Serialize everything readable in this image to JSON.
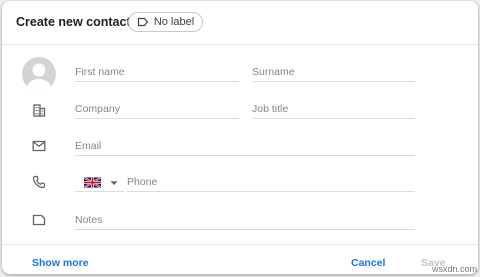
{
  "dialog": {
    "title": "Create new contact",
    "label_chip": {
      "text": "No label",
      "icon": "label-icon"
    }
  },
  "fields": {
    "first_name": {
      "placeholder": "First name"
    },
    "surname": {
      "placeholder": "Surname"
    },
    "company": {
      "placeholder": "Company"
    },
    "job_title": {
      "placeholder": "Job title"
    },
    "email": {
      "placeholder": "Email"
    },
    "phone": {
      "placeholder": "Phone",
      "country": "United Kingdom"
    },
    "notes": {
      "placeholder": "Notes"
    }
  },
  "icons": {
    "avatar": "avatar-placeholder-icon",
    "company": "building-icon",
    "email": "mail-icon",
    "phone": "phone-icon",
    "notes": "notes-icon",
    "flag": "uk-flag-icon",
    "dropdown": "caret-down-icon"
  },
  "footer": {
    "show_more": "Show more",
    "cancel": "Cancel",
    "save": "Save"
  },
  "watermark": "wsxdn.com",
  "colors": {
    "accent": "#1a73e8",
    "disabled": "#c4c4c4",
    "divider": "#dadce0",
    "icon": "#5f6368"
  }
}
